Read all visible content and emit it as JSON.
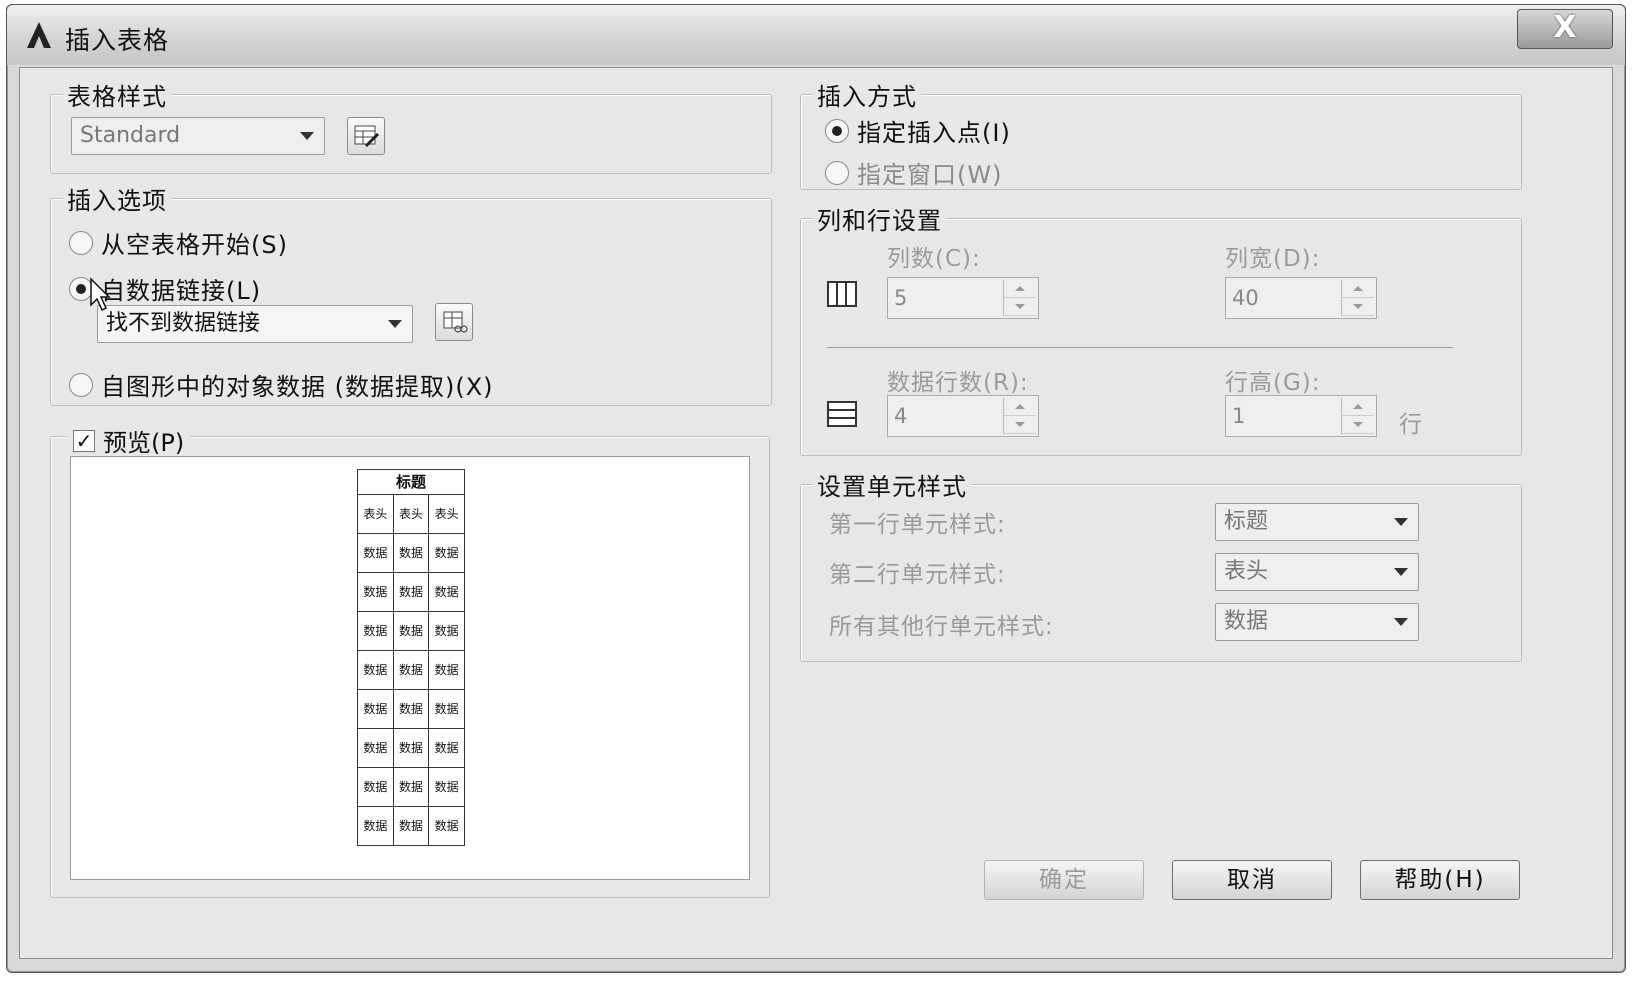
{
  "window": {
    "title": "插入表格",
    "close_glyph": "X"
  },
  "table_style": {
    "legend": "表格样式",
    "selected": "Standard"
  },
  "insert_options": {
    "legend": "插入选项",
    "opt_empty": "从空表格开始(S)",
    "opt_datalink": "自数据链接(L)",
    "datalink_selected": "找不到数据链接",
    "opt_extract": "自图形中的对象数据 (数据提取)(X)"
  },
  "preview": {
    "label": "预览(P)",
    "checked": true,
    "title_cell": "标题",
    "header_cell": "表头",
    "data_cell": "数据"
  },
  "insert_method": {
    "legend": "插入方式",
    "opt_point": "指定插入点(I)",
    "opt_window": "指定窗口(W)"
  },
  "col_row": {
    "legend": "列和行设置",
    "columns_label": "列数(C):",
    "columns_value": "5",
    "col_width_label": "列宽(D):",
    "col_width_value": "40",
    "data_rows_label": "数据行数(R):",
    "data_rows_value": "4",
    "row_height_label": "行高(G):",
    "row_height_value": "1",
    "row_unit": "行"
  },
  "cell_style": {
    "legend": "设置单元样式",
    "first_row_label": "第一行单元样式:",
    "first_row_value": "标题",
    "second_row_label": "第二行单元样式:",
    "second_row_value": "表头",
    "other_rows_label": "所有其他行单元样式:",
    "other_rows_value": "数据"
  },
  "buttons": {
    "ok": "确定",
    "cancel": "取消",
    "help": "帮助(H)"
  }
}
